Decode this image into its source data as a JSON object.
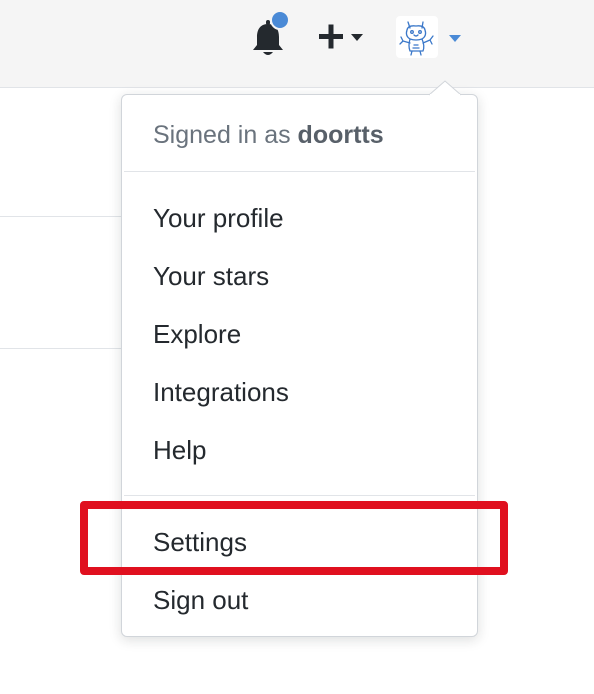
{
  "header": {
    "notification_icon": "bell-icon",
    "notification_indicator_color": "#4a8ad6",
    "create_icon": "plus-icon",
    "avatar_icon": "user-avatar",
    "caret_color": "#4a8ad6"
  },
  "dropdown": {
    "signed_in_prefix": "Signed in as",
    "username": "doortts",
    "items": [
      {
        "label": "Your profile"
      },
      {
        "label": "Your stars"
      },
      {
        "label": "Explore"
      },
      {
        "label": "Integrations"
      },
      {
        "label": "Help"
      },
      {
        "label": "Settings"
      },
      {
        "label": "Sign out"
      }
    ]
  },
  "highlight": {
    "color": "#e0101f",
    "target": "Settings"
  }
}
